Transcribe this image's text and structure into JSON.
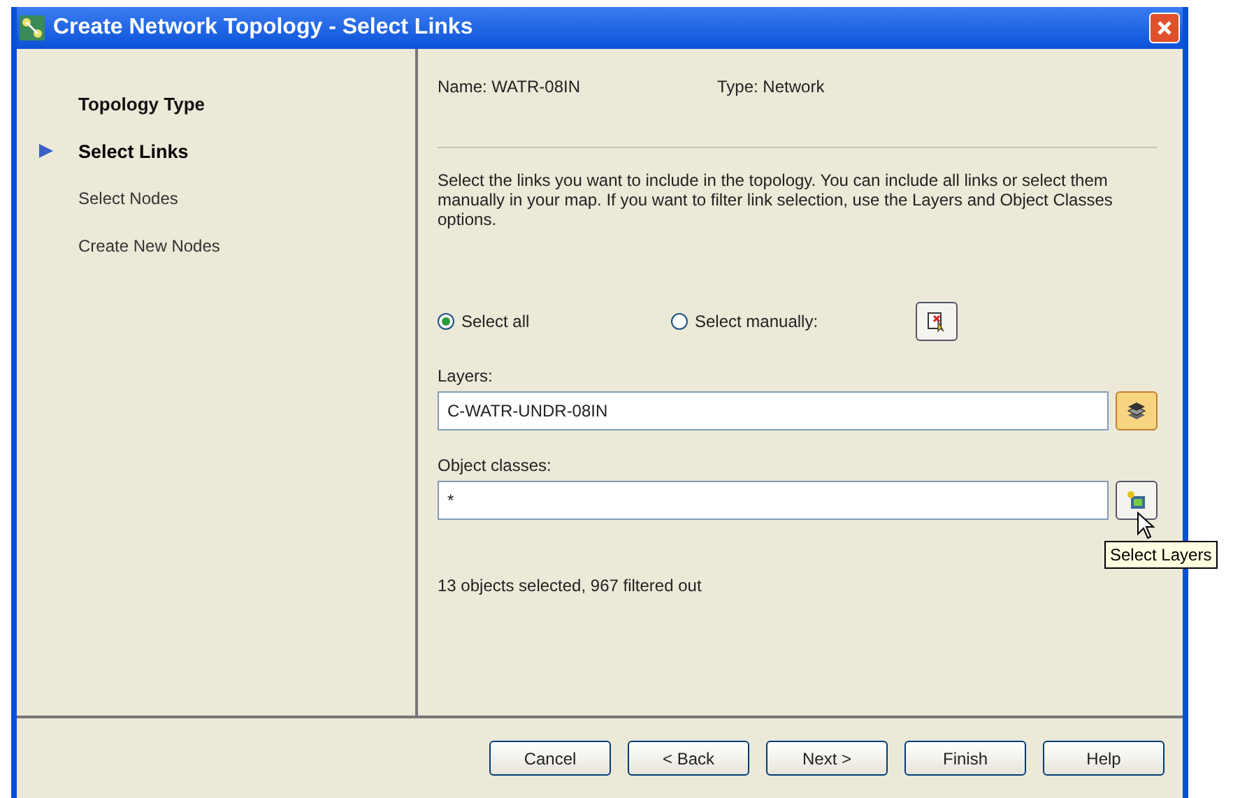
{
  "window": {
    "title": "Create Network Topology - Select Links"
  },
  "steps": [
    {
      "label": "Topology Type",
      "completed": true,
      "selected": false
    },
    {
      "label": "Select Links",
      "completed": false,
      "selected": true
    },
    {
      "label": "Select Nodes",
      "completed": false,
      "selected": false
    },
    {
      "label": "Create New Nodes",
      "completed": false,
      "selected": false
    }
  ],
  "name": "Name: WATR-08IN",
  "type": "Type: Network",
  "description": "Select the links you want to include in the topology. You can include all links or select them manually in your map. If you want to filter link selection, use the Layers and Object Classes options.",
  "selection_options": [
    {
      "label": "Select all",
      "selected": true
    },
    {
      "label": "Select manually:",
      "selected": false
    }
  ],
  "layers": {
    "label": "Layers:",
    "value": "C-WATR-UNDR-08IN"
  },
  "object_classes": {
    "label": "Object classes:",
    "value": "*"
  },
  "tooltip": "Select Layers",
  "status": "13 objects selected, 967 filtered out",
  "buttons": [
    "Cancel",
    "< Back",
    "Next >",
    "Finish",
    "Help"
  ]
}
